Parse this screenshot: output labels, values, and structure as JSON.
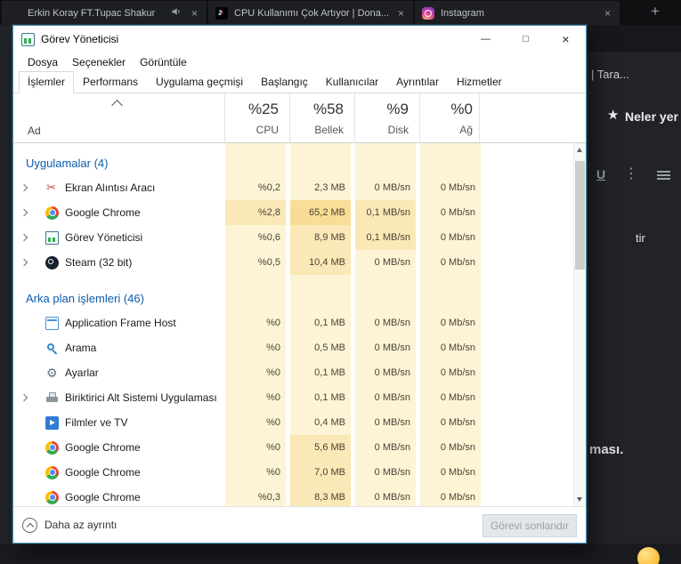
{
  "browser": {
    "tabs": [
      {
        "title": "Erkin Koray FT.Tupac Shakur",
        "favicon": "generic",
        "audio_playing": true
      },
      {
        "title": "CPU Kullanımı Çok Artıyor | Dona...",
        "favicon": "tiktok",
        "audio_playing": false
      },
      {
        "title": "Instagram",
        "favicon": "instagram",
        "audio_playing": false
      }
    ],
    "close_glyph": "×",
    "new_tab_glyph": "+",
    "page": {
      "address_fragment": "| Tara...",
      "nav_star": "★",
      "nav_fragment": "Neler yer",
      "toolbar_underline": "U",
      "toolbar_kebab": "⋮",
      "text_fragment_1": "tir",
      "text_fragment_2": "ması."
    }
  },
  "taskmanager": {
    "title": "Görev Yöneticisi",
    "window_controls": {
      "minimize": "—",
      "maximize": "□",
      "close": "×"
    },
    "menu": [
      {
        "label": "Dosya"
      },
      {
        "label": "Seçenekler"
      },
      {
        "label": "Görüntüle"
      }
    ],
    "tabs": [
      {
        "label": "İşlemler",
        "active": true
      },
      {
        "label": "Performans",
        "active": false
      },
      {
        "label": "Uygulama geçmişi",
        "active": false
      },
      {
        "label": "Başlangıç",
        "active": false
      },
      {
        "label": "Kullanıcılar",
        "active": false
      },
      {
        "label": "Ayrıntılar",
        "active": false
      },
      {
        "label": "Hizmetler",
        "active": false
      }
    ],
    "header": {
      "name_column": "Ad",
      "usage_columns": [
        {
          "total": "%25",
          "label": "CPU"
        },
        {
          "total": "%58",
          "label": "Bellek"
        },
        {
          "total": "%9",
          "label": "Disk"
        },
        {
          "total": "%0",
          "label": "Ağ"
        }
      ]
    },
    "heat_palette": [
      "#fdf4d6",
      "#fae9b6",
      "#f8dd96",
      "#f6d077"
    ],
    "groups": [
      {
        "label": "Uygulamalar (4)",
        "rows": [
          {
            "name": "Ekran Alıntısı Aracı",
            "icon": "snipping-tool",
            "expandable": true,
            "cells": [
              {
                "text": "%0,2",
                "heat": 0
              },
              {
                "text": "2,3 MB",
                "heat": 0
              },
              {
                "text": "0 MB/sn",
                "heat": 0
              },
              {
                "text": "0 Mb/sn",
                "heat": 0
              }
            ]
          },
          {
            "name": "Google Chrome",
            "icon": "chrome",
            "expandable": true,
            "cells": [
              {
                "text": "%2,8",
                "heat": 1
              },
              {
                "text": "65,2 MB",
                "heat": 2
              },
              {
                "text": "0,1 MB/sn",
                "heat": 1
              },
              {
                "text": "0 Mb/sn",
                "heat": 0
              }
            ]
          },
          {
            "name": "Görev Yöneticisi",
            "icon": "task-manager",
            "expandable": true,
            "cells": [
              {
                "text": "%0,6",
                "heat": 0
              },
              {
                "text": "8,9 MB",
                "heat": 1
              },
              {
                "text": "0,1 MB/sn",
                "heat": 1
              },
              {
                "text": "0 Mb/sn",
                "heat": 0
              }
            ]
          },
          {
            "name": "Steam (32 bit)",
            "icon": "steam",
            "expandable": true,
            "cells": [
              {
                "text": "%0,5",
                "heat": 0
              },
              {
                "text": "10,4 MB",
                "heat": 1
              },
              {
                "text": "0 MB/sn",
                "heat": 0
              },
              {
                "text": "0 Mb/sn",
                "heat": 0
              }
            ]
          }
        ]
      },
      {
        "label": "Arka plan işlemleri (46)",
        "rows": [
          {
            "name": "Application Frame Host",
            "icon": "app-frame",
            "expandable": false,
            "cells": [
              {
                "text": "%0",
                "heat": 0
              },
              {
                "text": "0,1 MB",
                "heat": 0
              },
              {
                "text": "0 MB/sn",
                "heat": 0
              },
              {
                "text": "0 Mb/sn",
                "heat": 0
              }
            ]
          },
          {
            "name": "Arama",
            "icon": "search",
            "expandable": false,
            "cells": [
              {
                "text": "%0",
                "heat": 0
              },
              {
                "text": "0,5 MB",
                "heat": 0
              },
              {
                "text": "0 MB/sn",
                "heat": 0
              },
              {
                "text": "0 Mb/sn",
                "heat": 0
              }
            ]
          },
          {
            "name": "Ayarlar",
            "icon": "settings",
            "expandable": false,
            "cells": [
              {
                "text": "%0",
                "heat": 0
              },
              {
                "text": "0,1 MB",
                "heat": 0
              },
              {
                "text": "0 MB/sn",
                "heat": 0
              },
              {
                "text": "0 Mb/sn",
                "heat": 0
              }
            ]
          },
          {
            "name": "Biriktirici Alt Sistemi Uygulaması",
            "icon": "printer",
            "expandable": true,
            "cells": [
              {
                "text": "%0",
                "heat": 0
              },
              {
                "text": "0,1 MB",
                "heat": 0
              },
              {
                "text": "0 MB/sn",
                "heat": 0
              },
              {
                "text": "0 Mb/sn",
                "heat": 0
              }
            ]
          },
          {
            "name": "Filmler ve TV",
            "icon": "movies",
            "expandable": false,
            "cells": [
              {
                "text": "%0",
                "heat": 0
              },
              {
                "text": "0,4 MB",
                "heat": 0
              },
              {
                "text": "0 MB/sn",
                "heat": 0
              },
              {
                "text": "0 Mb/sn",
                "heat": 0
              }
            ]
          },
          {
            "name": "Google Chrome",
            "icon": "chrome",
            "expandable": false,
            "cells": [
              {
                "text": "%0",
                "heat": 0
              },
              {
                "text": "5,6 MB",
                "heat": 1
              },
              {
                "text": "0 MB/sn",
                "heat": 0
              },
              {
                "text": "0 Mb/sn",
                "heat": 0
              }
            ]
          },
          {
            "name": "Google Chrome",
            "icon": "chrome",
            "expandable": false,
            "cells": [
              {
                "text": "%0",
                "heat": 0
              },
              {
                "text": "7,0 MB",
                "heat": 1
              },
              {
                "text": "0 MB/sn",
                "heat": 0
              },
              {
                "text": "0 Mb/sn",
                "heat": 0
              }
            ]
          },
          {
            "name": "Google Chrome",
            "icon": "chrome",
            "expandable": false,
            "cells": [
              {
                "text": "%0,3",
                "heat": 0
              },
              {
                "text": "8,3 MB",
                "heat": 1
              },
              {
                "text": "0 MB/sn",
                "heat": 0
              },
              {
                "text": "0 Mb/sn",
                "heat": 0
              }
            ]
          }
        ]
      }
    ],
    "footer": {
      "toggle_label": "Daha az ayrıntı",
      "end_task_label": "Görevi sonlandır",
      "end_task_enabled": false
    }
  }
}
